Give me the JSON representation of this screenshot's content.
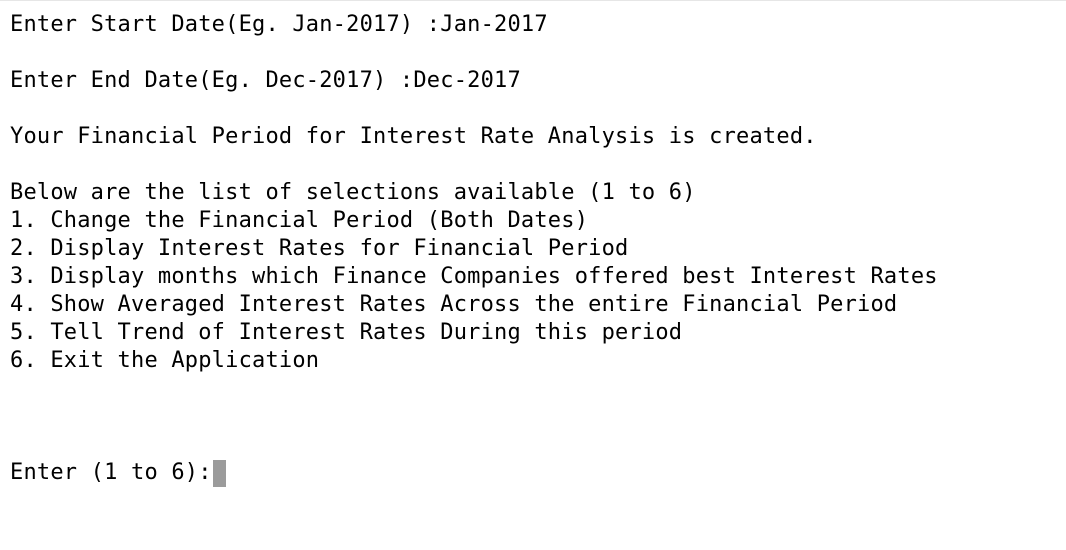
{
  "prompts": {
    "start_date_label": "Enter Start Date(Eg. Jan-2017) :",
    "start_date_value": "Jan-2017",
    "end_date_label": "Enter End Date(Eg. Dec-2017) :",
    "end_date_value": "Dec-2017"
  },
  "status_message": "Your Financial Period for Interest Rate Analysis is created.",
  "menu": {
    "header": "Below are the list of selections available (1 to 6)",
    "options": [
      "1. Change the Financial Period (Both Dates)",
      "2. Display Interest Rates for Financial Period",
      "3. Display months which Finance Companies offered best Interest Rates",
      "4. Show Averaged Interest Rates Across the entire Financial Period",
      "5. Tell Trend of Interest Rates During this period",
      "6. Exit the Application"
    ]
  },
  "selection_prompt": {
    "label": "Enter (1 to 6):",
    "value": ""
  },
  "colors": {
    "background": "#ffffff",
    "text": "#000000",
    "cursor": "#9b9b9b"
  }
}
